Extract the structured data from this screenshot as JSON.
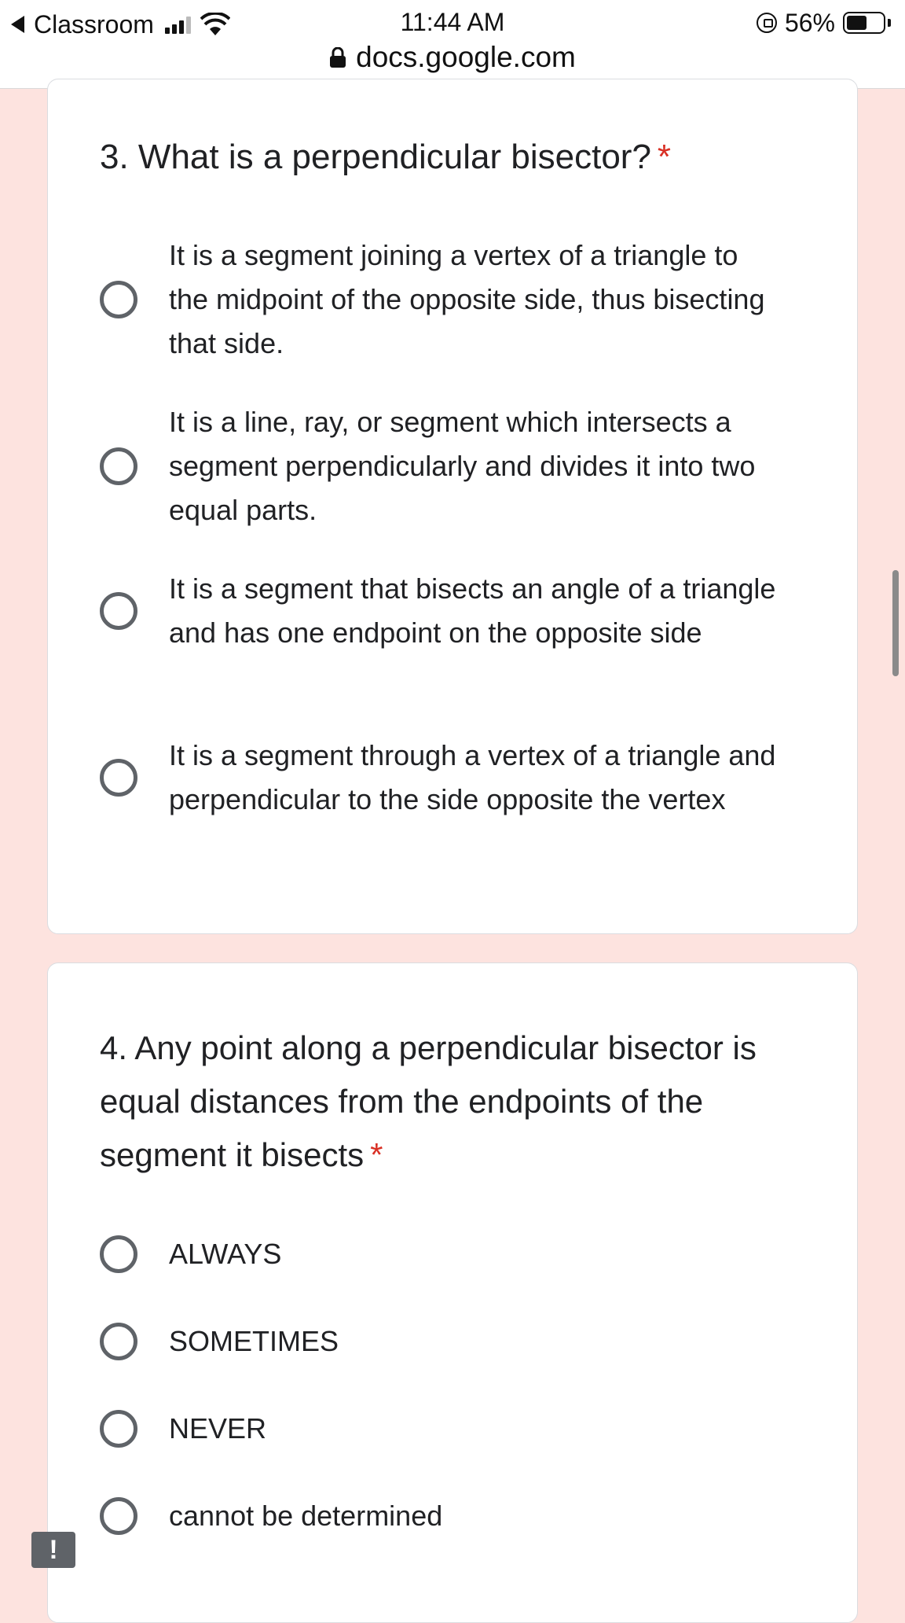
{
  "status_bar": {
    "back_app": "Classroom",
    "time": "11:44 AM",
    "url": "docs.google.com",
    "battery_percent": "56%"
  },
  "question3": {
    "title": "3. What is a perpendicular bisector?",
    "required_mark": "*",
    "options": [
      "It is a segment joining a vertex of a triangle to the midpoint of the opposite side, thus bisecting that side.",
      "It is a line, ray, or segment which intersects a segment perpendicularly and divides it into two equal parts.",
      "It is a segment that bisects an angle of a triangle and has one endpoint on the opposite side",
      "It is a segment through a vertex of a triangle and perpendicular to the side opposite the vertex"
    ]
  },
  "question4": {
    "title": "4. Any point along a perpendicular bisector is equal distances from the endpoints of the segment it bisects",
    "required_mark": "*",
    "options": [
      "ALWAYS",
      "SOMETIMES",
      "NEVER",
      "cannot be determined"
    ]
  },
  "feedback_button": "!",
  "colors": {
    "page_background": "#fde3df",
    "required": "#d93025",
    "radio_border": "#5f6368"
  }
}
